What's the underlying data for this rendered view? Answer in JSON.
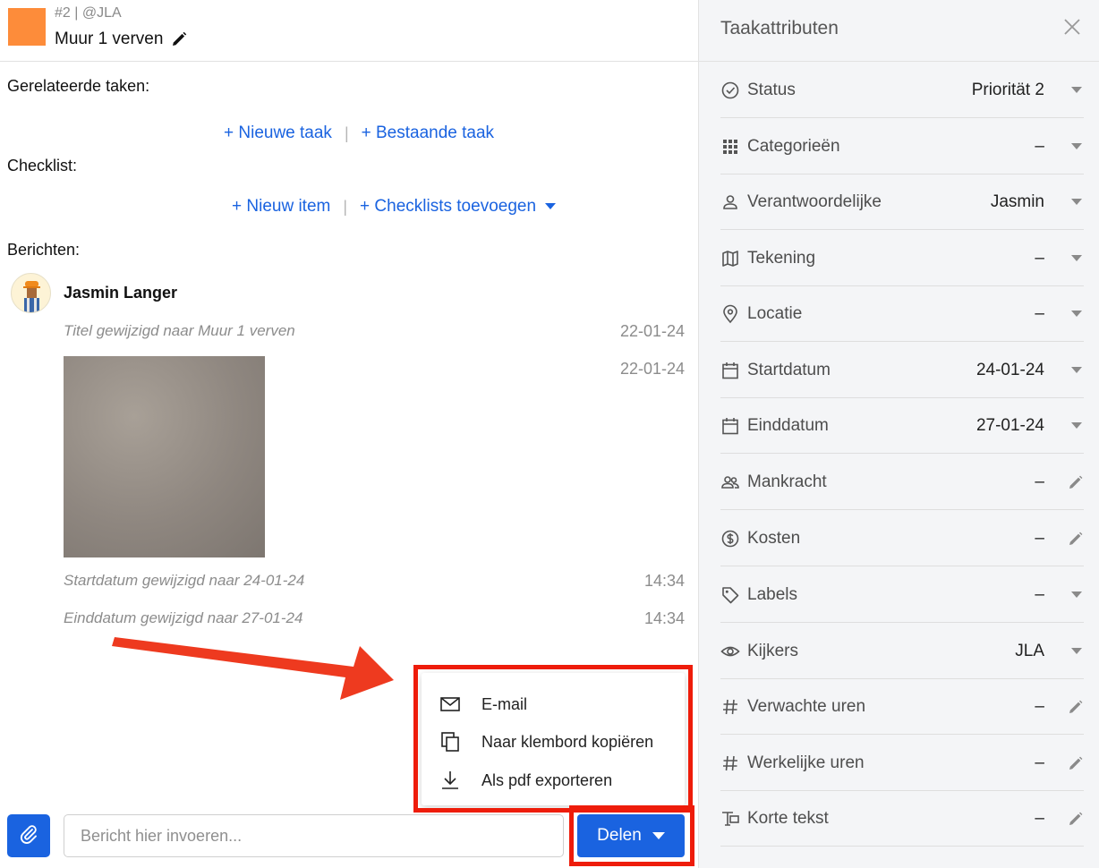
{
  "header": {
    "task_id": "#2 | @JLA",
    "title": "Muur 1 verven",
    "swatch_color": "#fd8c3a"
  },
  "sections": {
    "related_label": "Gerelateerde taken:",
    "new_task": "+ Nieuwe taak",
    "existing_task": "+ Bestaande taak",
    "checklist_label": "Checklist:",
    "new_item": "+ Nieuw item",
    "add_checklists": "+ Checklists toevoegen",
    "messages_label": "Berichten:",
    "separator": "|"
  },
  "messages": {
    "author": "Jasmin Langer",
    "items": [
      {
        "text": "Titel gewijzigd naar Muur 1 verven",
        "time": "22-01-24"
      },
      {
        "text": "",
        "time": "22-01-24"
      },
      {
        "text": "Startdatum gewijzigd naar 24-01-24",
        "time": "14:34"
      },
      {
        "text": "Einddatum gewijzigd naar 27-01-24",
        "time": "14:34"
      }
    ]
  },
  "share_menu": {
    "items": [
      {
        "label": "E-mail",
        "icon": "mail-icon"
      },
      {
        "label": "Naar klembord kopiëren",
        "icon": "copy-icon"
      },
      {
        "label": "Als pdf exporteren",
        "icon": "download-icon"
      }
    ]
  },
  "composer": {
    "placeholder": "Bericht hier invoeren...",
    "share_label": "Delen"
  },
  "panel": {
    "title": "Taakattributen",
    "attributes": [
      {
        "label": "Status",
        "value": "Priorität 2",
        "icon": "check-circle-icon",
        "control": "dropdown"
      },
      {
        "label": "Categorieën",
        "value": "–",
        "icon": "grid-icon",
        "control": "dropdown"
      },
      {
        "label": "Verantwoordelijke",
        "value": "Jasmin",
        "icon": "person-icon",
        "control": "dropdown"
      },
      {
        "label": "Tekening",
        "value": "–",
        "icon": "map-icon",
        "control": "dropdown"
      },
      {
        "label": "Locatie",
        "value": "–",
        "icon": "location-pin-icon",
        "control": "dropdown"
      },
      {
        "label": "Startdatum",
        "value": "24-01-24",
        "icon": "calendar-icon",
        "control": "dropdown"
      },
      {
        "label": "Einddatum",
        "value": "27-01-24",
        "icon": "calendar-icon",
        "control": "dropdown"
      },
      {
        "label": "Mankracht",
        "value": "–",
        "icon": "people-icon",
        "control": "edit"
      },
      {
        "label": "Kosten",
        "value": "–",
        "icon": "dollar-circle-icon",
        "control": "edit"
      },
      {
        "label": "Labels",
        "value": "–",
        "icon": "tag-icon",
        "control": "dropdown"
      },
      {
        "label": "Kijkers",
        "value": "JLA",
        "icon": "eye-icon",
        "control": "dropdown"
      },
      {
        "label": "Verwachte uren",
        "value": "–",
        "icon": "hash-icon",
        "control": "edit"
      },
      {
        "label": "Werkelijke uren",
        "value": "–",
        "icon": "hash-icon",
        "control": "edit"
      },
      {
        "label": "Korte tekst",
        "value": "–",
        "icon": "text-field-icon",
        "control": "edit"
      }
    ]
  },
  "colors": {
    "accent": "#1a63e0",
    "highlight": "#ee1c0a",
    "panel_bg": "#f4f5f7"
  }
}
